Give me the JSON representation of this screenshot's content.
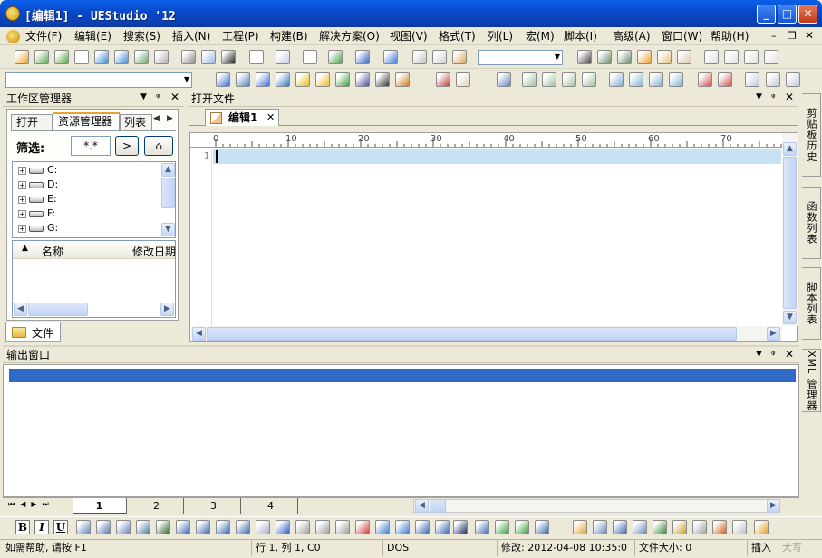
{
  "window": {
    "title": "[编辑1] - UEStudio '12"
  },
  "menu": [
    "文件(F)",
    "编辑(E)",
    "搜索(S)",
    "插入(N)",
    "工程(P)",
    "构建(B)",
    "解决方案(O)",
    "视图(V)",
    "格式(T)",
    "列(L)",
    "宏(M)",
    "脚本(I)",
    "高级(A)",
    "窗口(W)",
    "帮助(H)"
  ],
  "workspace": {
    "title": "工作区管理器",
    "tabs": [
      "打开",
      "资源管理器",
      "列表"
    ],
    "filter_label": "筛选:",
    "filter_value": "*.*",
    "drives": [
      "C:",
      "D:",
      "E:",
      "F:",
      "G:"
    ],
    "columns": [
      "名称",
      "修改日期"
    ],
    "bottom_tab": "文件"
  },
  "editor": {
    "panel_title": "打开文件",
    "file_tab": "编辑1",
    "line_number": "1",
    "ruler": [
      "0",
      "10",
      "20",
      "30",
      "40",
      "50",
      "60",
      "70"
    ]
  },
  "right_tabs": [
    "剪贴板历史",
    "函数列表",
    "脚本列表",
    "XML 管理器"
  ],
  "output": {
    "title": "输出窗口",
    "tabs": [
      "1",
      "2",
      "3",
      "4"
    ]
  },
  "status": {
    "help": "如需帮助, 请按 F1",
    "position": "行 1, 列 1, C0",
    "format": "DOS",
    "modified": "修改: 2012-04-08 10:35:0",
    "size": "文件大小: 0",
    "mode": "插入",
    "caps": "大写"
  },
  "colors": {
    "titlebar": "#0a50d8",
    "selection": "#3169c6",
    "current_line": "#c7e2f4"
  }
}
